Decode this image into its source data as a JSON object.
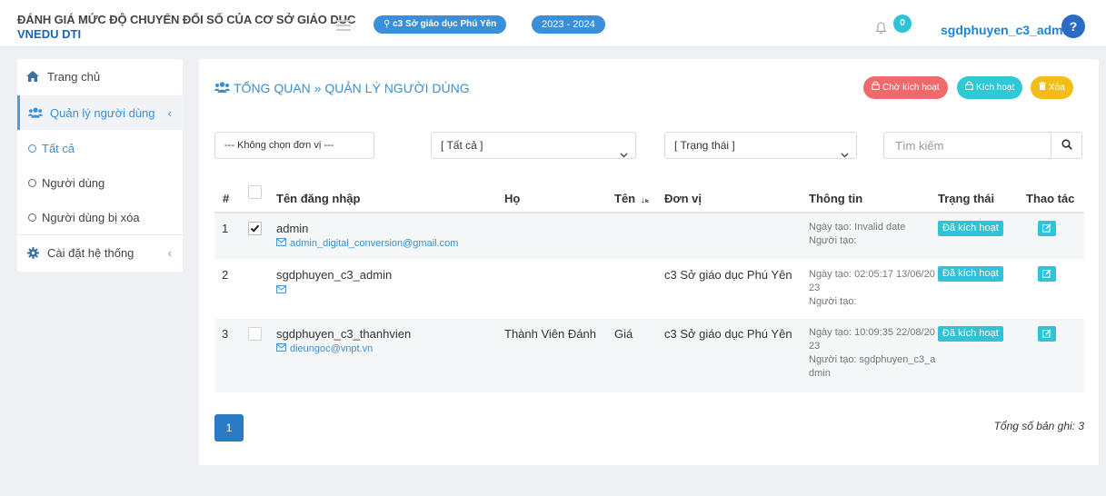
{
  "header": {
    "title_line1": "ĐÁNH GIÁ MỨC ĐỘ CHUYỂN ĐỔI SỐ CỦA CƠ SỞ GIÁO DỤC",
    "title_line2": "VNEDU DTI",
    "unit_pill": "c3 Sở giáo dục Phú Yên",
    "year_pill": "2023 - 2024",
    "notification_count": "0",
    "username": "sgdphuyen_c3_admin",
    "help_label": "?"
  },
  "sidebar": {
    "home": "Trang chủ",
    "user_management": "Quản lý người dùng",
    "sub_all": "Tất cả",
    "sub_users": "Người dùng",
    "sub_deleted": "Người dùng bị xóa",
    "settings": "Cài đặt hệ thống"
  },
  "main": {
    "breadcrumb": "TỔNG QUAN » QUẢN LÝ NGƯỜI DÙNG",
    "btn_pending": "Chờ kích hoạt",
    "btn_activate": "Kích hoạt",
    "btn_delete": "Xóa",
    "filter_unit": "--- Không chọn đơn vị ---",
    "filter_all": "[ Tất cả ]",
    "filter_status": "[ Trạng thái ]",
    "search_placeholder": "Tìm kiếm"
  },
  "table": {
    "headers": {
      "index": "#",
      "username": "Tên đăng nhập",
      "last_name": "Họ",
      "first_name": "Tên",
      "unit": "Đơn vị",
      "info": "Thông tin",
      "status": "Trạng thái",
      "actions": "Thao tác"
    },
    "rows": [
      {
        "index": "1",
        "username": "admin",
        "email": "admin_digital_conversion@gmail.com",
        "last_name": "",
        "first_name": "",
        "unit": "",
        "info_created": "Ngày tạo: Invalid date",
        "info_creator": "Người tạo:",
        "status": "Đã kích hoạt"
      },
      {
        "index": "2",
        "username": "sgdphuyen_c3_admin",
        "email": "",
        "last_name": "",
        "first_name": "",
        "unit": "c3 Sở giáo dục Phú Yên",
        "info_created": "Ngày tạo: 02:05:17 13/06/2023",
        "info_creator": "Người tạo:",
        "status": "Đã kích hoạt"
      },
      {
        "index": "3",
        "username": "sgdphuyen_c3_thanhvien",
        "email": "dieungoc@vnpt.vn",
        "last_name": "Thành Viên Đánh",
        "first_name": "Giá",
        "unit": "c3 Sở giáo dục Phú Yên",
        "info_created": "Ngày tạo: 10:09:35 22/08/2023",
        "info_creator": "Người tạo: sgdphuyen_c3_admin",
        "status": "Đã kích hoạt"
      }
    ]
  },
  "pagination": {
    "current_page": "1",
    "total_records": "Tổng số bản ghi: 3"
  }
}
